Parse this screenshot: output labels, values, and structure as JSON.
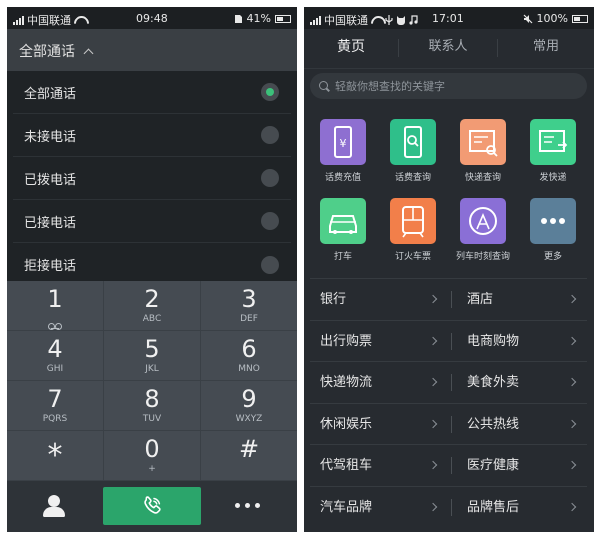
{
  "left_phone": {
    "status": {
      "carrier": "中国联通",
      "time": "09:48",
      "battery": "41%"
    },
    "filter": {
      "title": "全部通话",
      "chevron_icon": "chevron-up-icon"
    },
    "dropdown": [
      {
        "label": "全部通话",
        "selected": true
      },
      {
        "label": "未接电话",
        "selected": false
      },
      {
        "label": "已拨电话",
        "selected": false
      },
      {
        "label": "已接电话",
        "selected": false
      },
      {
        "label": "拒接电话",
        "selected": false
      }
    ],
    "keypad": [
      {
        "num": "1",
        "sub": ""
      },
      {
        "num": "2",
        "sub": "ABC"
      },
      {
        "num": "3",
        "sub": "DEF"
      },
      {
        "num": "4",
        "sub": "GHI"
      },
      {
        "num": "5",
        "sub": "JKL"
      },
      {
        "num": "6",
        "sub": "MNO"
      },
      {
        "num": "7",
        "sub": "PQRS"
      },
      {
        "num": "8",
        "sub": "TUV"
      },
      {
        "num": "9",
        "sub": "WXYZ"
      },
      {
        "num": "*",
        "sub": ""
      },
      {
        "num": "0",
        "sub": "+"
      },
      {
        "num": "#",
        "sub": ""
      }
    ],
    "call_color": "#2ba56b"
  },
  "right_phone": {
    "status": {
      "carrier": "中国联通",
      "time": "17:01",
      "battery": "100%"
    },
    "tabs": [
      "黄页",
      "联系人",
      "常用"
    ],
    "search_placeholder": "轻敲你想查找的关键字",
    "services": [
      {
        "label": "话费充值",
        "color": "#8e6fd1",
        "icon": "phone-recharge-icon"
      },
      {
        "label": "话费查询",
        "color": "#2fbf8a",
        "icon": "phone-bill-query-icon"
      },
      {
        "label": "快递查询",
        "color": "#f29b74",
        "icon": "express-query-icon"
      },
      {
        "label": "发快递",
        "color": "#3fcf8c",
        "icon": "send-express-icon"
      },
      {
        "label": "打车",
        "color": "#4fcf8a",
        "icon": "taxi-icon"
      },
      {
        "label": "订火车票",
        "color": "#f27f4a",
        "icon": "train-ticket-icon"
      },
      {
        "label": "列车时刻查询",
        "color": "#8a6fd6",
        "icon": "train-schedule-icon"
      },
      {
        "label": "更多",
        "color": "#5b7f99",
        "icon": "more-icon"
      }
    ],
    "categories": [
      [
        "银行",
        "酒店"
      ],
      [
        "出行购票",
        "电商购物"
      ],
      [
        "快递物流",
        "美食外卖"
      ],
      [
        "休闲娱乐",
        "公共热线"
      ],
      [
        "代驾租车",
        "医疗健康"
      ],
      [
        "汽车品牌",
        "品牌售后"
      ]
    ]
  }
}
